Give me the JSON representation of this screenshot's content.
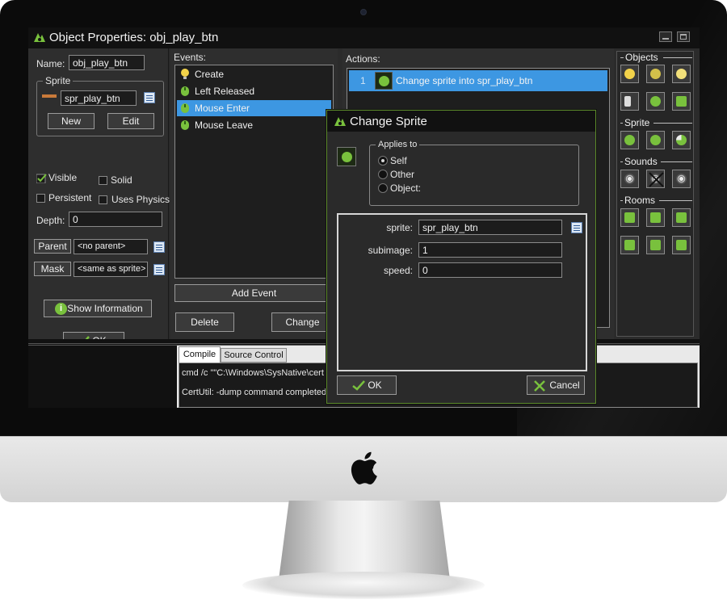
{
  "window": {
    "title": "Object Properties: obj_play_btn"
  },
  "properties": {
    "name_label": "Name:",
    "name_value": "obj_play_btn",
    "sprite_group_label": "Sprite",
    "sprite_value": "spr_play_btn",
    "new_label": "New",
    "edit_label": "Edit",
    "visible_label": "Visible",
    "visible_checked": true,
    "solid_label": "Solid",
    "persistent_label": "Persistent",
    "uses_physics_label": "Uses Physics",
    "depth_label": "Depth:",
    "depth_value": "0",
    "parent_label": "Parent",
    "parent_value": "<no parent>",
    "mask_label": "Mask",
    "mask_value": "<same as sprite>",
    "show_info_label": "Show Information",
    "ok_label": "OK"
  },
  "events": {
    "label": "Events:",
    "items": [
      {
        "label": "Create",
        "icon": "lightbulb-icon",
        "selected": false
      },
      {
        "label": "Left Released",
        "icon": "mouse-icon",
        "selected": false
      },
      {
        "label": "Mouse Enter",
        "icon": "mouse-icon",
        "selected": true
      },
      {
        "label": "Mouse Leave",
        "icon": "mouse-icon",
        "selected": false
      }
    ],
    "add_event_label": "Add Event",
    "delete_label": "Delete",
    "change_label": "Change"
  },
  "actions": {
    "label": "Actions:",
    "items": [
      {
        "index": "1",
        "label": "Change sprite into spr_play_btn"
      }
    ]
  },
  "toolbox": {
    "objects_label": "Objects",
    "sprite_label": "Sprite",
    "sounds_label": "Sounds",
    "rooms_label": "Rooms"
  },
  "output": {
    "tabs": [
      "Compile",
      "Source Control"
    ],
    "lines": [
      "cmd /c \"\"C:\\Windows\\SysNative\\cert",
      "CertUtil: -dump command completed"
    ]
  },
  "dialog": {
    "title": "Change Sprite",
    "applies_to_label": "Applies to",
    "options": [
      {
        "label": "Self",
        "selected": true
      },
      {
        "label": "Other",
        "selected": false
      },
      {
        "label": "Object:",
        "selected": false
      }
    ],
    "sprite_label": "sprite:",
    "sprite_value": "spr_play_btn",
    "subimage_label": "subimage:",
    "subimage_value": "1",
    "speed_label": "speed:",
    "speed_value": "0",
    "ok_label": "OK",
    "cancel_label": "Cancel"
  },
  "colors": {
    "accent_green": "#79c13d",
    "selection_blue": "#3d97e2",
    "background_dark": "#2b2b2b"
  }
}
